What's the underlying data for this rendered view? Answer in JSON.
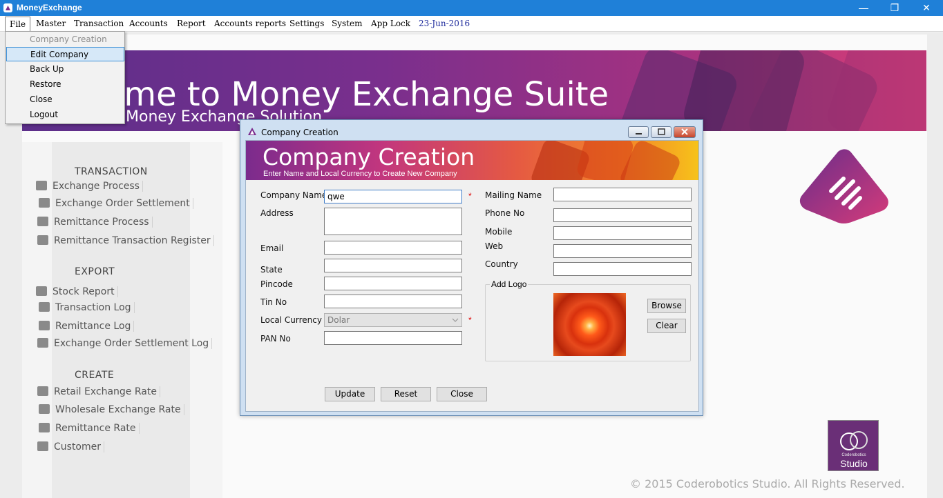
{
  "window": {
    "title": "MoneyExchange",
    "minimize_glyph": "—",
    "restore_glyph": "❐",
    "close_glyph": "✕"
  },
  "menubar": {
    "items": [
      "File",
      "Master",
      "Transaction",
      "Accounts",
      "Report",
      "Accounts reports",
      "Settings",
      "System",
      "App Lock"
    ],
    "date": "23-Jun-2016"
  },
  "file_menu": {
    "items": [
      {
        "label": "Company Creation",
        "state": "disabled"
      },
      {
        "label": "Edit Company",
        "state": "highlighted"
      },
      {
        "label": "Back Up",
        "state": "normal"
      },
      {
        "label": "Restore",
        "state": "normal"
      },
      {
        "label": "Close",
        "state": "normal"
      },
      {
        "label": "Logout",
        "state": "normal"
      }
    ]
  },
  "banner": {
    "welcome": "ome to Money Exchange Suite",
    "subtitle": "Money Exchange Solution"
  },
  "sidebar": {
    "transaction_heading": "TRANSACTION",
    "transaction_items": [
      "Exchange Process",
      "Exchange Order Settlement",
      "Remittance Process",
      "Remittance Transaction Register"
    ],
    "export_heading": "EXPORT",
    "export_items": [
      "Stock Report",
      "Transaction Log",
      "Remittance Log",
      "Exchange Order Settlement Log"
    ],
    "create_heading": "CREATE",
    "create_items": [
      "Retail Exchange Rate",
      "Wholesale Exchange Rate",
      "Remittance Rate",
      "Customer"
    ]
  },
  "dialog": {
    "title": "Company Creation",
    "banner_title": "Company Creation",
    "banner_subtitle": "Enter Name and Local Currency to Create New Company",
    "labels": {
      "company_name": "Company Name",
      "address": "Address",
      "email": "Email",
      "state": "State",
      "pincode": "Pincode",
      "tin_no": "Tin No",
      "local_currency": "Local Currency",
      "pan_no": "PAN No",
      "mailing_name": "Mailing Name",
      "phone_no": "Phone No",
      "mobile": "Mobile",
      "web": "Web",
      "country": "Country",
      "add_logo": "Add Logo"
    },
    "values": {
      "company_name": "qwe",
      "address": "",
      "email": "",
      "state": "",
      "pincode": "",
      "tin_no": "",
      "local_currency": "Dolar",
      "pan_no": "",
      "mailing_name": "",
      "phone_no": "",
      "mobile": "",
      "web": "",
      "country": ""
    },
    "required_mark": "*",
    "buttons": {
      "browse": "Browse",
      "clear": "Clear",
      "update": "Update",
      "reset": "Reset",
      "close": "Close"
    }
  },
  "footer": {
    "copyright": "© 2015 Coderobotics Studio. All Rights Reserved.",
    "studio_small": "Coderobotics",
    "studio_label": "Studio"
  },
  "colors": {
    "titlebar": "#1f80d8",
    "banner_start": "#5c2f8a",
    "banner_end": "#d93f78",
    "menu_highlight": "#d6e8f8",
    "required": "#dd0000"
  }
}
